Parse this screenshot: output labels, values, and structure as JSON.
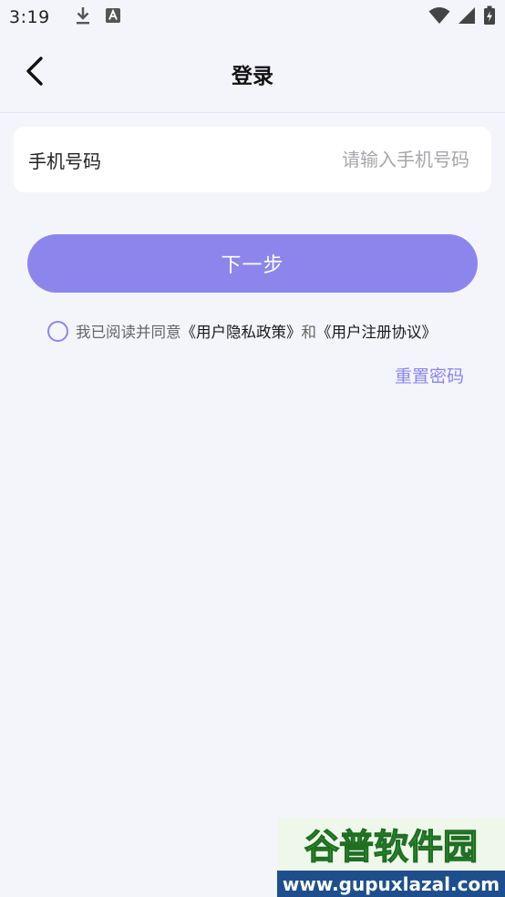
{
  "status_bar": {
    "time": "3:19",
    "icons": [
      "download-icon",
      "font-a-icon",
      "wifi-icon",
      "cell-signal-icon",
      "battery-icon"
    ]
  },
  "header": {
    "back_icon": "chevron-left-icon",
    "title": "登录"
  },
  "phone": {
    "label": "手机号码",
    "value": "",
    "placeholder": "请输入手机号码"
  },
  "next_button": {
    "label": "下一步"
  },
  "agreement": {
    "checked": false,
    "prefix": "我已阅读并同意",
    "privacy_link": "《用户隐私政策》",
    "conjunction": "和",
    "terms_link": "《用户注册协议》"
  },
  "reset": {
    "label": "重置密码"
  },
  "watermark": {
    "brand": "谷普软件园",
    "url": "www.gupuxlazal.com"
  },
  "colors": {
    "accent": "#8c86ec",
    "background": "#f4f4fb",
    "card": "#ffffff",
    "watermark_green": "#3cae3f"
  }
}
